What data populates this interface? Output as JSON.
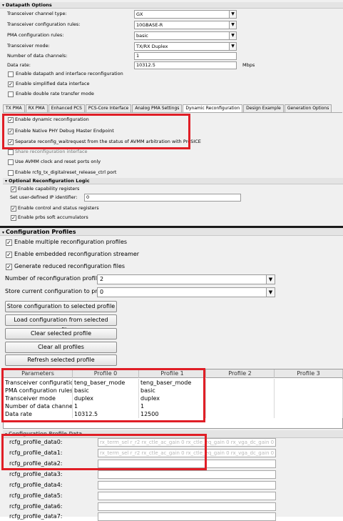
{
  "top": {
    "section_title": "Datapath Options",
    "fields": [
      {
        "label": "Transceiver channel type:",
        "value": "GX"
      },
      {
        "label": "Transceiver configuration rules:",
        "value": "10GBASE-R"
      },
      {
        "label": "PMA configuration rules:",
        "value": "basic"
      },
      {
        "label": "Transceiver mode:",
        "value": "TX/RX Duplex"
      }
    ],
    "num_channels_label": "Number of data channels:",
    "num_channels_value": "1",
    "data_rate_label": "Data rate:",
    "data_rate_value": "10312.5",
    "data_rate_unit": "Mbps",
    "checks": [
      {
        "label": "Enable datapath and interface reconfiguration",
        "checked": false
      },
      {
        "label": "Enable simplified data interface",
        "checked": true
      },
      {
        "label": "Enable double rate transfer mode",
        "checked": false
      }
    ],
    "tabs": [
      "TX PMA",
      "RX PMA",
      "Enhanced PCS",
      "PCS-Core Interface",
      "Analog PMA Settings",
      "Dynamic Reconfiguration",
      "Design Example",
      "Generation Options"
    ],
    "active_tab": "Dynamic Reconfiguration",
    "dyn_checks": [
      {
        "label": "Enable dynamic reconfiguration",
        "checked": true
      },
      {
        "label": "Enable Native PHY Debug Master Endpoint",
        "checked": true
      },
      {
        "label": "Separate reconfig_waitrequest from the status of AVMM arbitration with PreSICE",
        "checked": true
      },
      {
        "label": "Share reconfiguration interface",
        "checked": false
      },
      {
        "label": "Use AVMM clock and reset ports only",
        "checked": false
      },
      {
        "label": "Enable rcfg_tx_digitalreset_release_ctrl port",
        "checked": false
      }
    ],
    "optional_title": "Optional Reconfiguration Logic",
    "enable_capability": "Enable capability registers",
    "ip_identifier_label": "Set user-defined IP identifier:",
    "ip_identifier_value": "0",
    "enable_csr": "Enable control and status registers",
    "enable_prbs": "Enable prbs soft accumulators"
  },
  "bottom": {
    "section_title": "Configuration Profiles",
    "checks": [
      {
        "label": "Enable multiple reconfiguration profiles",
        "checked": true
      },
      {
        "label": "Enable embedded reconfiguration streamer",
        "checked": true
      },
      {
        "label": "Generate reduced reconfiguration files",
        "checked": true
      }
    ],
    "num_profiles_label": "Number of reconfiguration profiles:",
    "num_profiles_value": "2",
    "store_current_label": "Store current configuration to profile::",
    "store_current_value": "0",
    "buttons": [
      "Store configuration to selected profile",
      "Load configuration from selected profile",
      "Clear selected profile",
      "Clear all profiles",
      "Refresh selected profile"
    ],
    "table": {
      "headers": [
        "Parameters",
        "Profile 0",
        "Profile 1",
        "Profile 2",
        "Profile 3"
      ],
      "rows": [
        [
          "Transceiver configuration...",
          "teng_baser_mode",
          "teng_baser_mode",
          "",
          ""
        ],
        [
          "PMA configuration rules",
          "basic",
          "basic",
          "",
          ""
        ],
        [
          "Transceiver mode",
          "duplex",
          "duplex",
          "",
          ""
        ],
        [
          "Number of data channels",
          "1",
          "1",
          "",
          ""
        ],
        [
          "Data rate",
          "10312.5",
          "12500",
          "",
          ""
        ]
      ]
    },
    "profile_data_title": "Configuration Profile Data",
    "profile_data": [
      {
        "label": "rcfg_profile_data0:",
        "value": "rx_term_sel r_r2 rx_ctle_ac_gain 0 rx_ctle_eq_gain 0 rx_vga_dc_gain 0"
      },
      {
        "label": "rcfg_profile_data1:",
        "value": "rx_term_sel r_r2 rx_ctle_ac_gain 0 rx_ctle_eq_gain 0 rx_vga_dc_gain 0"
      },
      {
        "label": "rcfg_profile_data2:",
        "value": ""
      },
      {
        "label": "rcfg_profile_data3:",
        "value": ""
      },
      {
        "label": "rcfg_profile_data4:",
        "value": ""
      },
      {
        "label": "rcfg_profile_data5:",
        "value": ""
      },
      {
        "label": "rcfg_profile_data6:",
        "value": ""
      },
      {
        "label": "rcfg_profile_data7:",
        "value": ""
      }
    ]
  },
  "colors": {
    "highlight": "#e01e26",
    "panel": "#f0f0f0"
  }
}
